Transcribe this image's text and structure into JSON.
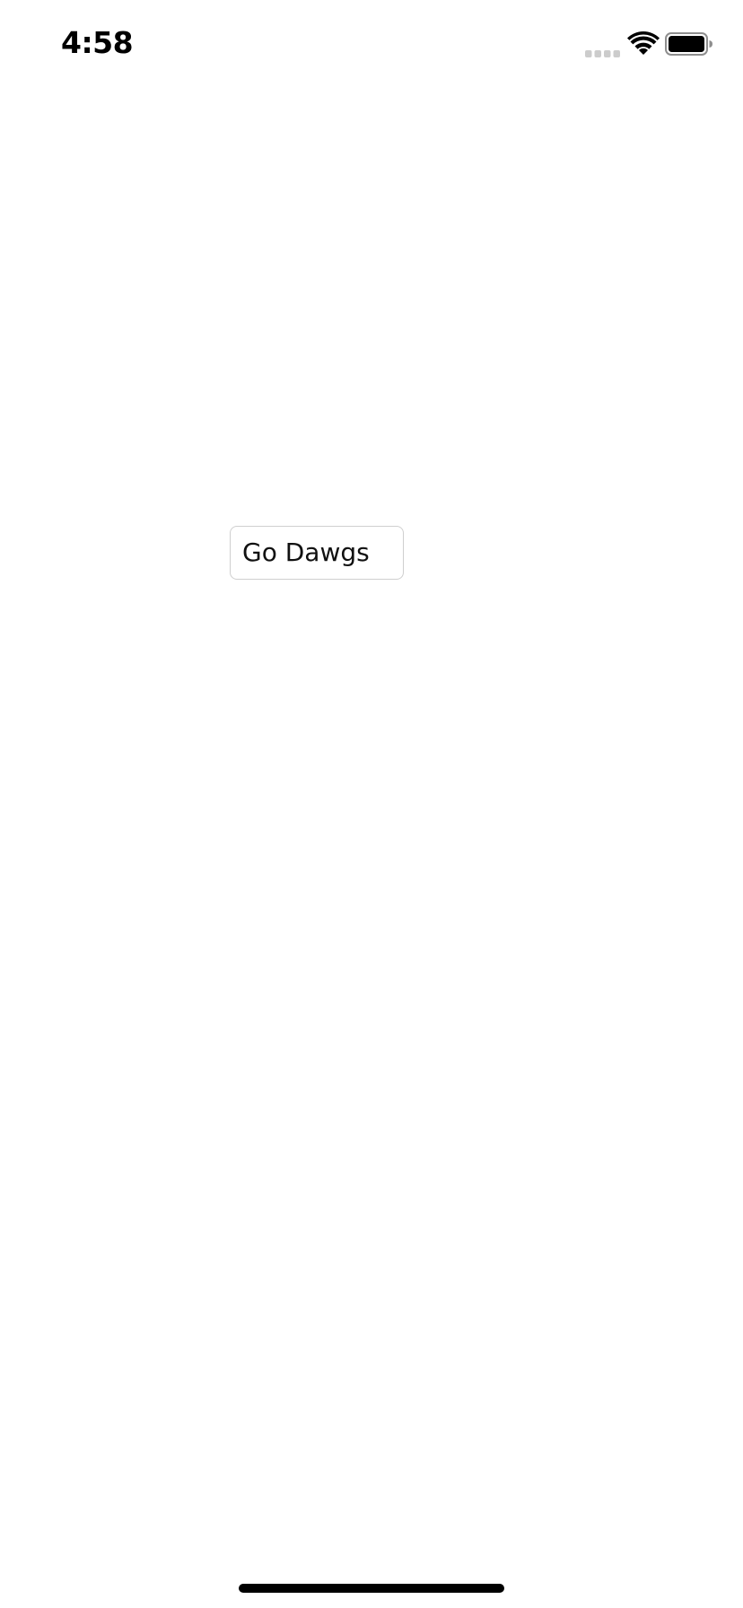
{
  "status_bar": {
    "time": "4:58",
    "signal_icon": "signal-dots-icon",
    "wifi_icon": "wifi-icon",
    "battery_icon": "battery-full-icon"
  },
  "main": {
    "button_label": "Go Dawgs"
  },
  "colors": {
    "background": "#ffffff",
    "button_border": "#cfcfcf",
    "text": "#111111"
  }
}
